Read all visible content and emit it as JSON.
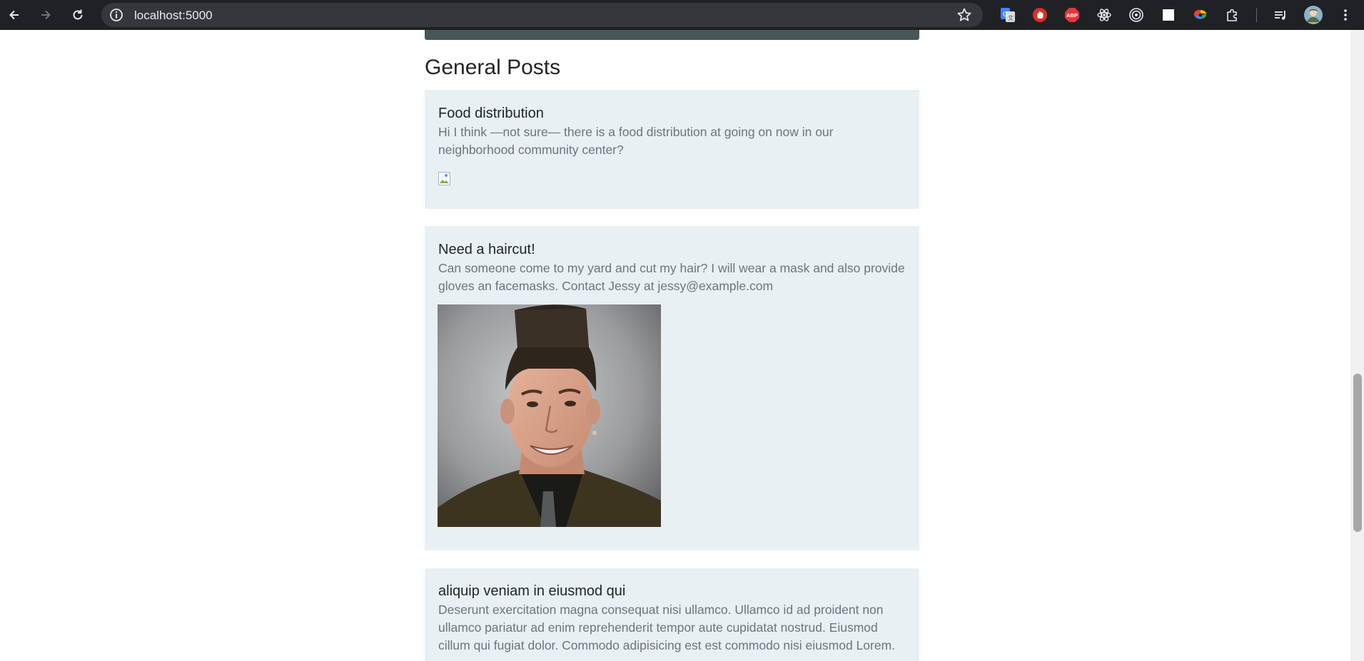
{
  "browser": {
    "url": "localhost:5000",
    "extensions": [
      "google-translate-icon",
      "stop-hand-icon",
      "adblock-plus-icon",
      "react-devtools-icon",
      "target-icon",
      "white-square-icon",
      "color-wheel-icon",
      "puzzle-icon"
    ],
    "menu_icons": [
      "media-playlist-icon",
      "profile-avatar",
      "more-vert-icon"
    ]
  },
  "page": {
    "section_title": "General Posts",
    "posts": [
      {
        "title": "Food distribution",
        "body": "Hi I think —not sure— there is a food distribution at going on now in our neighborhood community center?",
        "image": "broken-image-icon"
      },
      {
        "title": "Need a haircut!",
        "body": "Can someone come to my yard and cut my hair? I will wear a mask and also provide gloves an facemasks. Contact Jessy at jessy@example.com",
        "image": "flat-top-haircut-photo"
      },
      {
        "title": "aliquip veniam in eiusmod qui",
        "body": "Deserunt exercitation magna consequat nisi ullamco. Ullamco id ad proident non ullamco pariatur ad enim reprehenderit tempor aute cupidatat nostrud. Eiusmod cillum qui fugiat dolor. Commodo adipisicing est est commodo nisi eiusmod Lorem."
      }
    ]
  },
  "colors": {
    "chrome_bg": "#202124",
    "omnibox_bg": "#36373b",
    "post_bg": "#e8f0f4",
    "top_strip": "#485658",
    "title_text": "#212529",
    "body_text": "#6c757d"
  }
}
